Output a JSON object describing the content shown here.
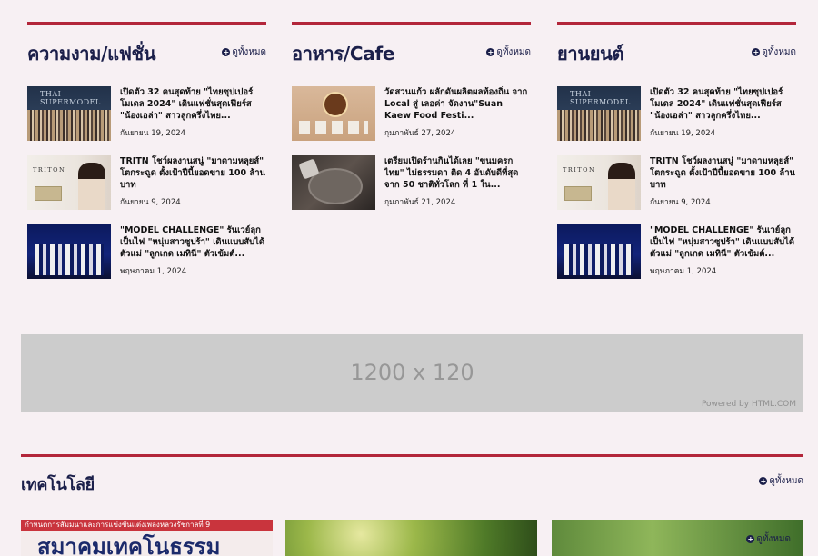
{
  "sections": [
    {
      "title": "ความงาม/แฟชั่น",
      "view_all": "ดูทั้งหมด",
      "items": [
        {
          "title": "เปิดตัว 32 คนสุดท้าย \"ไทยซุปเปอร์โมเดล 2024\" เดินแฟชั่นสุดเฟียร์ส \"น้องเอล่า\" สาวลูกครึ่งไทย...",
          "date": "กันยายน 19, 2024",
          "thumb": "supermodel-photo"
        },
        {
          "title": "TRITN โชว์ผลงานสนู่ \"มาดามหลุยส์\" โตกระฉูด ตั้งเป้าปีนี้ยอดขาย 100 ล้านบาท",
          "date": "กันยายน 9, 2024",
          "thumb": "triton-photo"
        },
        {
          "title": "\"MODEL CHALLENGE\" รันเวย์ลุกเป็นไฟ \"หนุ่มสาวซูปร้า\" เดินแบบสับได้ตัวแม่ \"ลูกเกด เมทินี\" ตัวเข้มต์...",
          "date": "พฤษภาคม 1, 2024",
          "thumb": "model-photo"
        }
      ]
    },
    {
      "title": "อาหาร/Cafe",
      "view_all": "ดูทั้งหมด",
      "items": [
        {
          "title": "วัดสวนแก้ว ผลักดันผลิตผลท้องถิ่น จาก Local สู่ เลอค่า จัดงาน\"Suan Kaew Food Festi...",
          "date": "กุมภาพันธ์ 27, 2024",
          "thumb": "cafe-photo"
        },
        {
          "title": "เตรียมเปิดร้านกินได้เลย \"ขนมครกไทย\" ไม่ธรรมดา ติด 4 อันดับดีที่สุดจาก 50 ชาติทั่วโลก ที่ 1 ใน...",
          "date": "กุมภาพันธ์ 21, 2024",
          "thumb": "dessert-photo"
        }
      ]
    },
    {
      "title": "ยานยนต์",
      "view_all": "ดูทั้งหมด",
      "items": [
        {
          "title": "เปิดตัว 32 คนสุดท้าย \"ไทยซุปเปอร์โมเดล 2024\" เดินแฟชั่นสุดเฟียร์ส \"น้องเอล่า\" สาวลูกครึ่งไทย...",
          "date": "กันยายน 19, 2024",
          "thumb": "supermodel-photo"
        },
        {
          "title": "TRITN โชว์ผลงานสนู่ \"มาดามหลุยส์\" โตกระฉูด ตั้งเป้าปีนี้ยอดขาย 100 ล้านบาท",
          "date": "กันยายน 9, 2024",
          "thumb": "triton-photo"
        },
        {
          "title": "\"MODEL CHALLENGE\" รันเวย์ลุกเป็นไฟ \"หนุ่มสาวซูปร้า\" เดินแบบสับได้ตัวแม่ \"ลูกเกด เมทินี\" ตัวเข้มต์...",
          "date": "พฤษภาคม 1, 2024",
          "thumb": "model-photo"
        }
      ]
    }
  ],
  "thumb_text": {
    "supermodel": "THAI SUPERMODEL",
    "triton": "TRITON"
  },
  "ad": {
    "size_label": "1200 x 120",
    "powered_by": "Powered by HTML.COM"
  },
  "tech": {
    "title": "เทคโนโลยี",
    "view_all": "ดูทั้งหมด",
    "image1_band": "กำหนดการสัมมนาและการแข่งขันแต่งเพลงหลวงรัชกาลที่ 9",
    "image1_big": "สมาคมเทคโนธรรม",
    "image3_view_all": "ดูทั้งหมด"
  },
  "colors": {
    "accent_line": "#b3263a",
    "heading": "#1b1f4a",
    "background": "#f7f0f3",
    "ad_bg": "#cccccc"
  }
}
